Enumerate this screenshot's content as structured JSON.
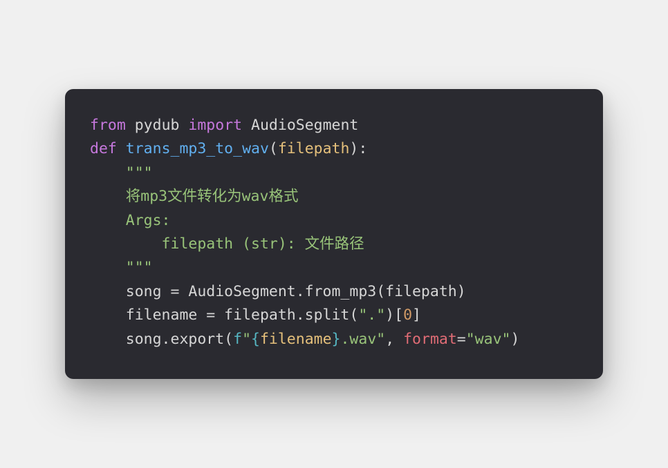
{
  "code": {
    "line1": {
      "from": "from",
      "mod1": "pydub",
      "import": "import",
      "mod2": "AudioSegment"
    },
    "line2": {
      "def": "def",
      "func": "trans_mp3_to_wav",
      "lp": "(",
      "param": "filepath",
      "rp": "):"
    },
    "line3": {
      "q": "    \"\"\""
    },
    "line4": {
      "doc": "    将mp3文件转化为wav格式"
    },
    "line5": {
      "doc": "    Args:"
    },
    "line6": {
      "doc": "        filepath (str): 文件路径"
    },
    "line7": {
      "q": "    \"\"\""
    },
    "line8": {
      "text": "    song = AudioSegment.from_mp3(filepath)"
    },
    "line9": {
      "a": "    filename = filepath.split(",
      "s": "\".\"",
      "b": ")[",
      "n": "0",
      "c": "]"
    },
    "line10": {
      "a": "    song.export(",
      "fpre": "f",
      "q1": "\"",
      "lb": "{",
      "var": "filename",
      "rb": "}",
      "rest": ".wav\"",
      "comma": ", ",
      "kwarg": "format",
      "eq": "=",
      "val": "\"wav\"",
      "close": ")"
    }
  },
  "chart_data": {
    "type": "table",
    "title": "Python code snippet: convert mp3 to wav using pydub",
    "lines": [
      "from pydub import AudioSegment",
      "def trans_mp3_to_wav(filepath):",
      "    \"\"\"",
      "    将mp3文件转化为wav格式",
      "    Args:",
      "        filepath (str): 文件路径",
      "    \"\"\"",
      "    song = AudioSegment.from_mp3(filepath)",
      "    filename = filepath.split(\".\")[0]",
      "    song.export(f\"{filename}.wav\", format=\"wav\")"
    ]
  }
}
